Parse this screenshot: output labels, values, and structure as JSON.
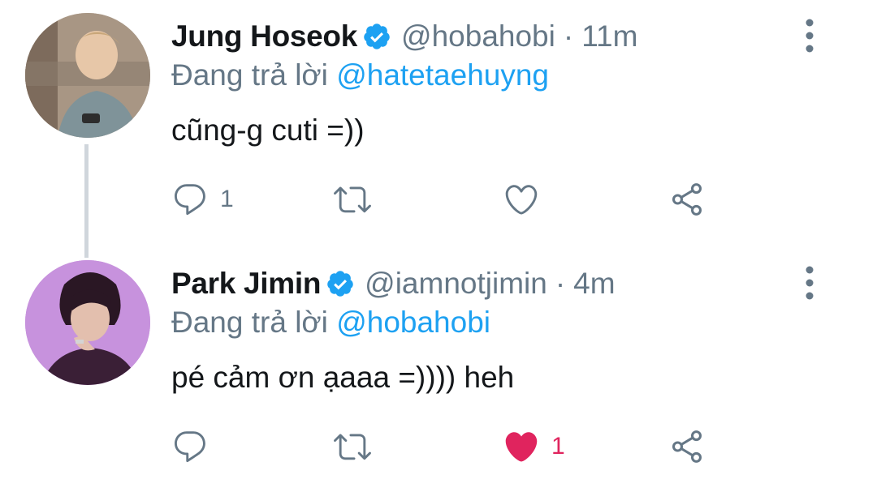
{
  "tweets": [
    {
      "display_name": "Jung Hoseok",
      "handle": "@hobahobi",
      "separator": "·",
      "time": "11m",
      "reply_prefix": "Đang trả lời",
      "reply_to": "@hatetaehuyng",
      "text": "cũng-g cuti =))",
      "reply_count": "1",
      "retweet_count": "",
      "like_count": "",
      "liked": false
    },
    {
      "display_name": "Park Jimin",
      "handle": "@iamnotjimin",
      "separator": "·",
      "time": "4m",
      "reply_prefix": "Đang trả lời",
      "reply_to": "@hobahobi",
      "text": "pé cảm ơn ạaaa =)))) heh",
      "reply_count": "",
      "retweet_count": "",
      "like_count": "1",
      "liked": true
    }
  ],
  "icons": {
    "verified": "verified-badge-icon",
    "more": "more-vertical-icon",
    "reply": "reply-bubble-icon",
    "retweet": "retweet-icon",
    "like": "heart-icon",
    "share": "share-icon"
  },
  "colors": {
    "text": "#14171a",
    "secondary": "#657786",
    "link": "#1da1f2",
    "like": "#e0245e",
    "thread_line": "#d0d6dc"
  }
}
